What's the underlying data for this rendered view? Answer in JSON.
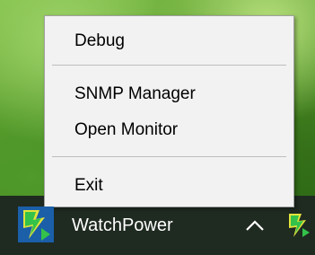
{
  "menu": {
    "items": [
      {
        "label": "Debug"
      },
      {
        "label": "SNMP Manager"
      },
      {
        "label": "Open Monitor"
      },
      {
        "label": "Exit"
      }
    ]
  },
  "taskbar": {
    "app_label": "WatchPower",
    "app_icon": "watchpower-icon",
    "show_hidden_icon": "chevron-up-icon",
    "tray_icon": "watchpower-tray-icon"
  },
  "colors": {
    "menu_background": "#f2f2f2",
    "taskbar_background": "#1f2a21",
    "icon_green": "#34c24a",
    "icon_yellow": "#e3e43a"
  }
}
